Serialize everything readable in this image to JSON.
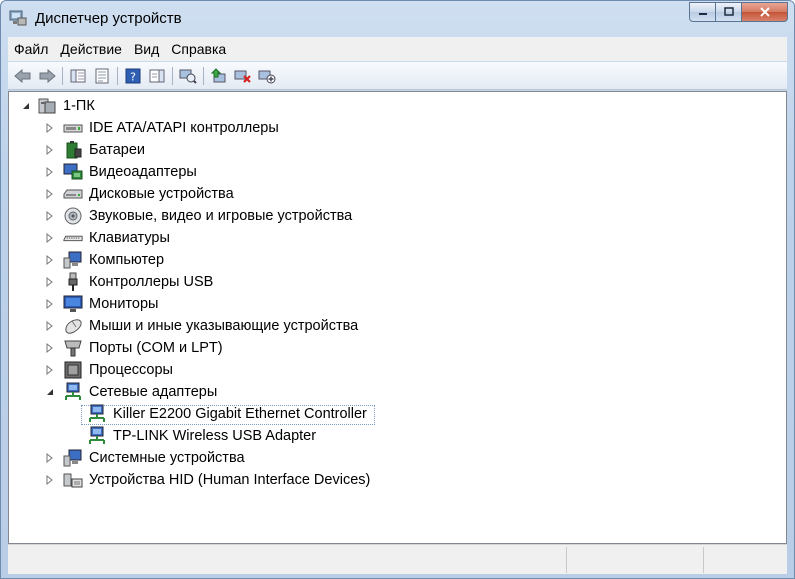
{
  "window": {
    "title": "Диспетчер устройств",
    "buttons": {
      "minimize_icon": "minimize-icon",
      "maximize_icon": "maximize-icon",
      "close_icon": "close-icon"
    },
    "close_color": "#c94a30"
  },
  "menu": [
    "Файл",
    "Действие",
    "Вид",
    "Справка"
  ],
  "toolbar": {
    "icons": [
      "back-arrow-icon",
      "forward-arrow-icon",
      "show-hide-console-tree-icon",
      "properties-icon",
      "help-icon",
      "action-pane-icon",
      "scan-hardware-icon",
      "update-driver-icon",
      "uninstall-icon",
      "disable-device-icon"
    ]
  },
  "tree": {
    "root": {
      "label": "1-ПК",
      "expanded": true
    },
    "categories": [
      {
        "label": "IDE ATA/ATAPI контроллеры",
        "icon": "ide-controller-icon",
        "expanded": false
      },
      {
        "label": "Батареи",
        "icon": "battery-icon",
        "expanded": false
      },
      {
        "label": "Видеоадаптеры",
        "icon": "video-adapter-icon",
        "expanded": false
      },
      {
        "label": "Дисковые устройства",
        "icon": "disk-drive-icon",
        "expanded": false
      },
      {
        "label": "Звуковые, видео и игровые устройства",
        "icon": "sound-device-icon",
        "expanded": false
      },
      {
        "label": "Клавиатуры",
        "icon": "keyboard-icon",
        "expanded": false
      },
      {
        "label": "Компьютер",
        "icon": "computer-icon",
        "expanded": false
      },
      {
        "label": "Контроллеры USB",
        "icon": "usb-controller-icon",
        "expanded": false
      },
      {
        "label": "Мониторы",
        "icon": "monitor-icon",
        "expanded": false
      },
      {
        "label": "Мыши и иные указывающие устройства",
        "icon": "mouse-icon",
        "expanded": false
      },
      {
        "label": "Порты (COM и LPT)",
        "icon": "port-icon",
        "expanded": false
      },
      {
        "label": "Процессоры",
        "icon": "processor-icon",
        "expanded": false
      },
      {
        "label": "Сетевые адаптеры",
        "icon": "network-adapter-icon",
        "expanded": true,
        "children": [
          {
            "label": "Killer E2200 Gigabit Ethernet Controller",
            "icon": "network-adapter-icon",
            "selected": true
          },
          {
            "label": "TP-LINK Wireless USB Adapter",
            "icon": "network-adapter-icon",
            "selected": false
          }
        ]
      },
      {
        "label": "Системные устройства",
        "icon": "system-device-icon",
        "expanded": false
      },
      {
        "label": "Устройства HID (Human Interface Devices)",
        "icon": "hid-device-icon",
        "expanded": false
      }
    ]
  },
  "status": {
    "panes": [
      "",
      "",
      ""
    ]
  }
}
